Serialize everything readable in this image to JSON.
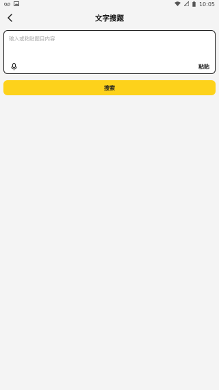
{
  "status_bar": {
    "time": "10:05",
    "icons": [
      "voicemail-icon",
      "image-icon",
      "wifi-icon",
      "signal-icon",
      "battery-icon"
    ]
  },
  "header": {
    "title": "文字搜题",
    "back_icon": "chevron-left-icon"
  },
  "input": {
    "placeholder": "输入或粘贴题目内容",
    "value": "",
    "mic_icon": "microphone-icon",
    "paste_label": "粘贴"
  },
  "search_button": {
    "label": "搜索",
    "color": "#fdd21b"
  },
  "colors": {
    "background": "#f4f4f4",
    "accent": "#fdd21b",
    "border": "#222222"
  }
}
